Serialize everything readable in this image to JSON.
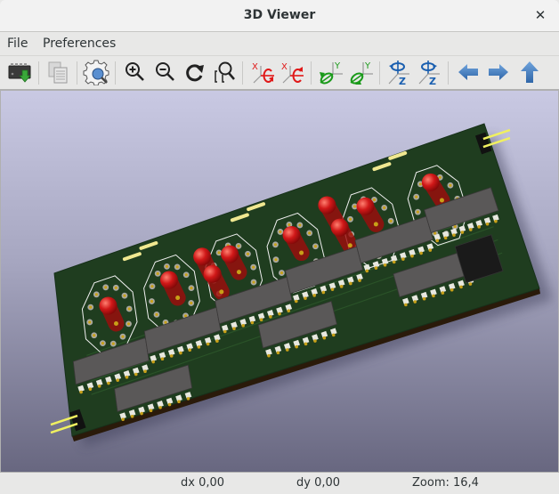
{
  "window": {
    "title": "3D Viewer",
    "close_icon": "close-icon"
  },
  "menubar": {
    "items": [
      {
        "label": "File"
      },
      {
        "label": "Preferences"
      }
    ]
  },
  "toolbar": {
    "buttons": [
      {
        "icon": "reload-board-icon",
        "tooltip": "Reload board"
      },
      {
        "icon": "copy-to-clipboard-icon",
        "tooltip": "Copy 3D image to clipboard"
      },
      {
        "icon": "settings-icon",
        "tooltip": "Set display options"
      },
      {
        "icon": "zoom-in-icon",
        "tooltip": "Zoom in"
      },
      {
        "icon": "zoom-out-icon",
        "tooltip": "Zoom out"
      },
      {
        "icon": "redraw-icon",
        "tooltip": "Redraw view"
      },
      {
        "icon": "zoom-fit-icon",
        "tooltip": "Fit in page"
      },
      {
        "icon": "rotate-x-cw-icon",
        "tooltip": "Rotate X clockwise"
      },
      {
        "icon": "rotate-x-ccw-icon",
        "tooltip": "Rotate X counterclockwise"
      },
      {
        "icon": "rotate-y-cw-icon",
        "tooltip": "Rotate Y clockwise"
      },
      {
        "icon": "rotate-y-ccw-icon",
        "tooltip": "Rotate Y counterclockwise"
      },
      {
        "icon": "rotate-z-cw-icon",
        "tooltip": "Rotate Z clockwise"
      },
      {
        "icon": "rotate-z-ccw-icon",
        "tooltip": "Rotate Z counterclockwise"
      },
      {
        "icon": "move-left-icon",
        "tooltip": "Move left"
      },
      {
        "icon": "move-right-icon",
        "tooltip": "Move right"
      },
      {
        "icon": "move-up-icon",
        "tooltip": "Move up"
      }
    ]
  },
  "viewport": {
    "background_top": "#c9c9e3",
    "background_bottom": "#686780",
    "board_color": "#1f3d1f",
    "silkscreen_color": "#f0f0f0",
    "led_color": "#d01818",
    "ic_color": "#5a5858",
    "pin_color": "#e8e8e0",
    "pad_color": "#c8a018",
    "header_pin_color": "#f0f060",
    "led_count": 10,
    "ic_count": 9,
    "nixie_socket_count": 6
  },
  "statusbar": {
    "dx": "dx 0,00",
    "dy": "dy 0,00",
    "zoom": "Zoom: 16,4"
  }
}
